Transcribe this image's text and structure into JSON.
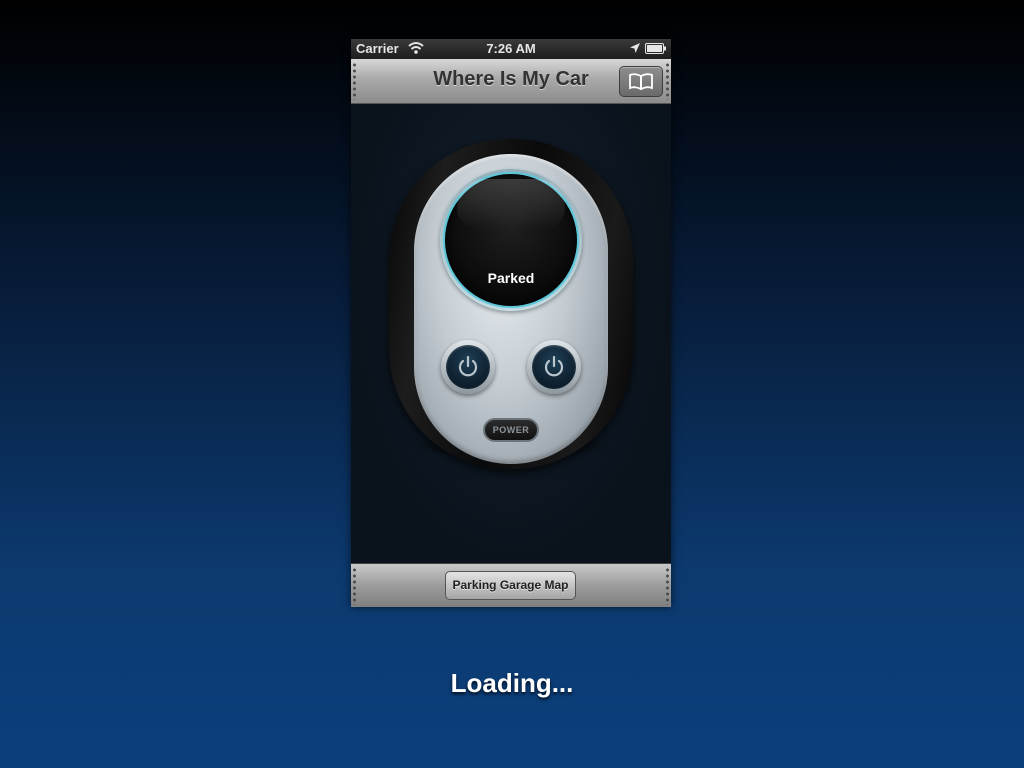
{
  "status_bar": {
    "carrier": "Carrier",
    "time": "7:26 AM"
  },
  "navbar": {
    "title": "Where Is My Car",
    "book_icon": "book-icon"
  },
  "remote": {
    "status": "Parked",
    "power_label": "POWER",
    "left_button_icon": "power-icon",
    "right_button_icon": "power-icon",
    "accent_color": "#5cc6d9"
  },
  "toolbar": {
    "garage_map_label": "Parking Garage Map"
  },
  "overlay": {
    "loading_text": "Loading..."
  }
}
